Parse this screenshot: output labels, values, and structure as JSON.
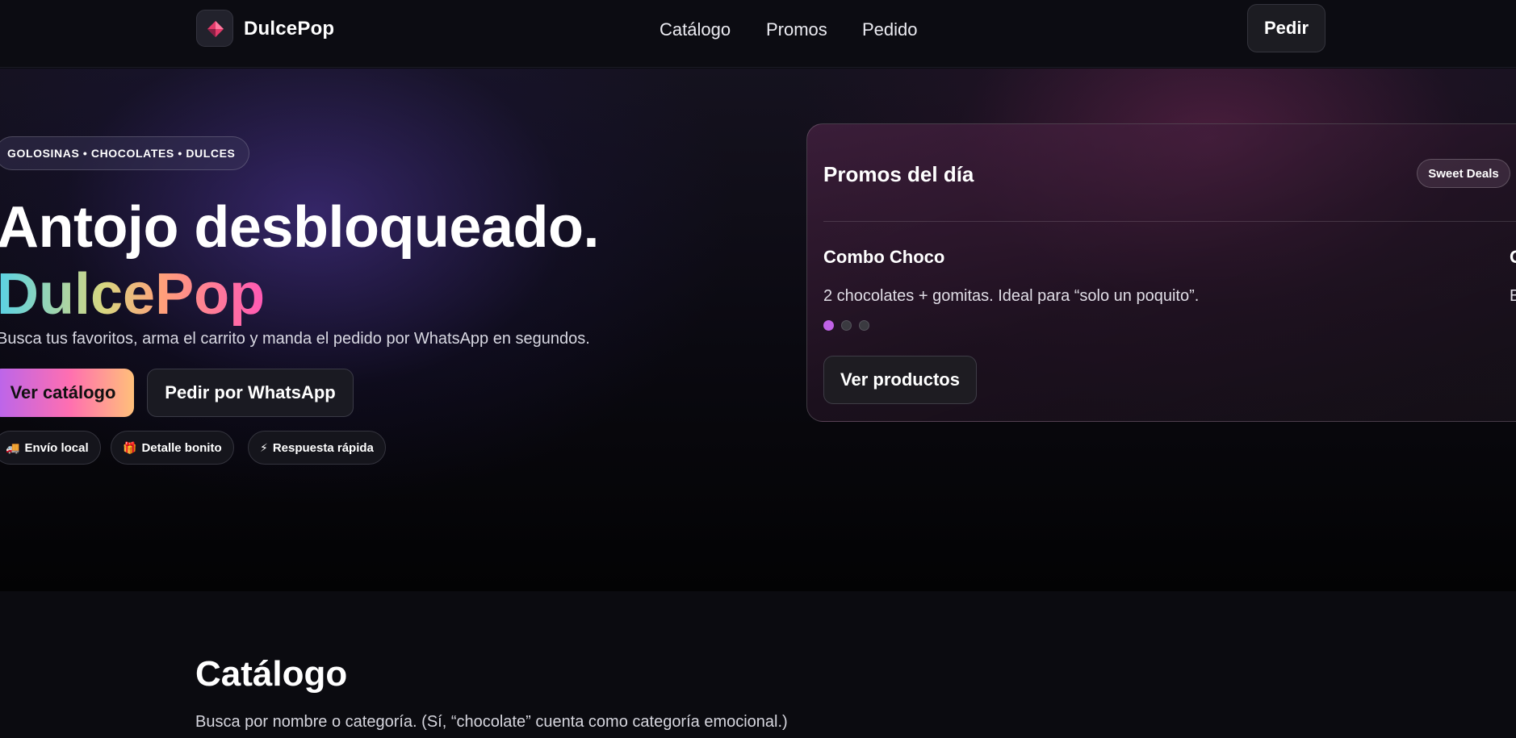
{
  "brand": {
    "name": "DulcePop"
  },
  "nav": {
    "links": [
      "Catálogo",
      "Promos",
      "Pedido"
    ],
    "cta": "Pedir"
  },
  "hero": {
    "tag": "GOLOSINAS • CHOCOLATES • DULCES",
    "headline": "Antojo desbloqueado.",
    "headline_brand": "DulcePop",
    "subtitle": "Busca tus favoritos, arma el carrito y manda el pedido por WhatsApp en segundos.",
    "primary_button": "Ver catálogo",
    "secondary_button": "Pedir por WhatsApp",
    "chips": [
      {
        "icon": "truck-icon",
        "glyph": "🚚",
        "label": "Envío local"
      },
      {
        "icon": "gift-icon",
        "glyph": "🎁",
        "label": "Detalle bonito"
      },
      {
        "icon": "lightning-icon",
        "glyph": "⚡",
        "label": "Respuesta rápida"
      }
    ]
  },
  "promo": {
    "title": "Promos del día",
    "badge": "Sweet Deals",
    "slides": [
      {
        "title": "Combo Choco",
        "desc": "2 chocolates + gomitas. Ideal para “solo un poquito”."
      },
      {
        "title": "G",
        "desc": "B"
      }
    ],
    "active_slide": 0,
    "slide_count": 3,
    "button": "Ver productos"
  },
  "catalog": {
    "title": "Catálogo",
    "subtitle": "Busca por nombre o categoría. (Sí, “chocolate” cuenta como categoría emocional.)"
  },
  "colors": {
    "accent_purple": "#c062e6",
    "accent_pink": "#ff58b5",
    "background": "#0a0a0f"
  }
}
